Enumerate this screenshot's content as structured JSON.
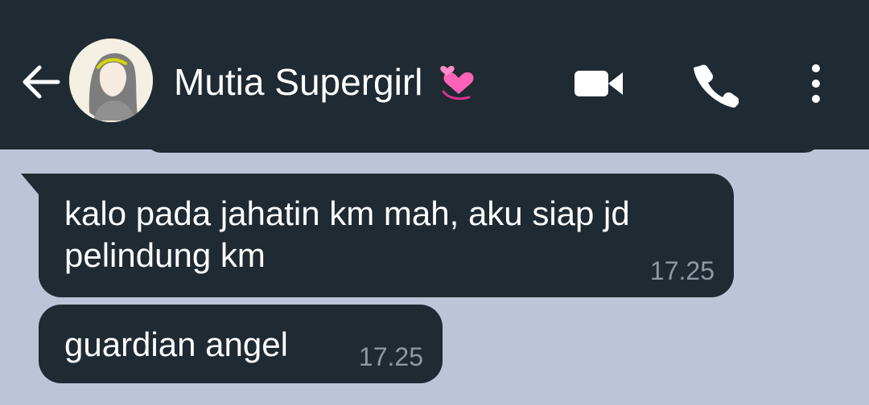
{
  "header": {
    "contact_name": "Mutia Supergirl",
    "status_emoji": "heart-emoji",
    "back_icon": "back-arrow-icon",
    "video_icon": "video-call-icon",
    "phone_icon": "phone-call-icon",
    "menu_icon": "more-options-icon"
  },
  "messages": [
    {
      "text": "kalo pada jahatin km mah, aku siap jd pelindung km",
      "time": "17.25"
    },
    {
      "text": "guardian angel",
      "time": "17.25"
    }
  ],
  "colors": {
    "header_bg": "#1f2a33",
    "chat_bg": "#bdc4d8",
    "bubble_bg": "#1f2a33",
    "time_text": "#8f99a4",
    "accent_heart": "#ff4fa8"
  }
}
